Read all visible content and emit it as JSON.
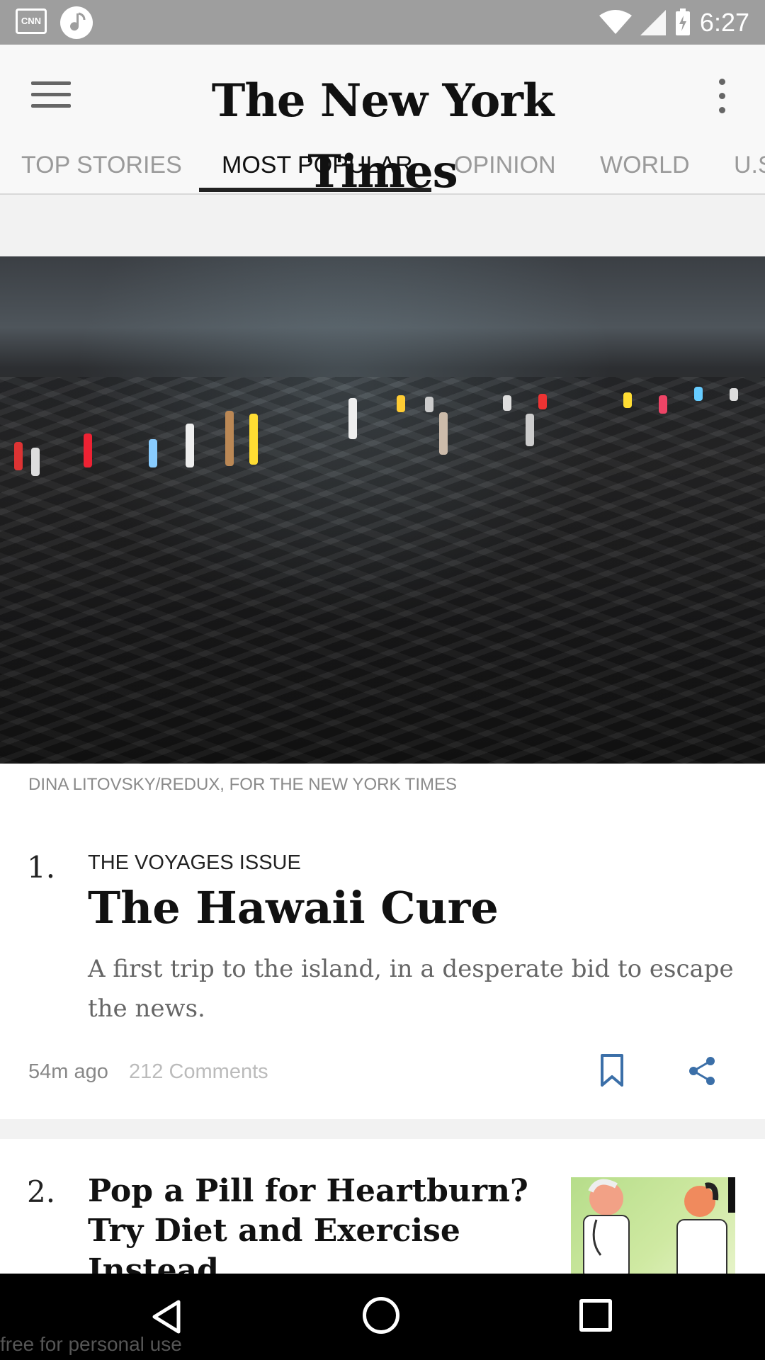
{
  "status_bar": {
    "time": "6:27",
    "notification_icons": [
      "cnn-icon",
      "music-icon"
    ],
    "system_icons": [
      "wifi-icon",
      "signal-icon",
      "battery-charging-icon"
    ],
    "cnn_label": "CNN"
  },
  "app_bar": {
    "masthead": "The New York Times",
    "menu_icon": "menu-icon",
    "overflow_icon": "more-vert-icon"
  },
  "tabs": [
    {
      "label": "TOP STORIES",
      "active": false
    },
    {
      "label": "MOST POPULAR",
      "active": true
    },
    {
      "label": "OPINION",
      "active": false
    },
    {
      "label": "WORLD",
      "active": false
    },
    {
      "label": "U.S.",
      "active": false
    }
  ],
  "articles": [
    {
      "rank": "1.",
      "photo_credit": "DINA LITOVSKY/REDUX, FOR THE NEW YORK TIMES",
      "kicker": "THE VOYAGES ISSUE",
      "headline": "The Hawaii Cure",
      "summary": "A first trip to the island, in a desperate bid to escape the news.",
      "time_ago": "54m ago",
      "comments": "212 Comments"
    },
    {
      "rank": "2.",
      "headline": "Pop a Pill for Heartburn? Try Diet and Exercise Instead"
    }
  ],
  "nav_bar": {
    "icons": [
      "back-icon",
      "home-icon",
      "recents-icon"
    ]
  },
  "watermark": "free for personal use"
}
